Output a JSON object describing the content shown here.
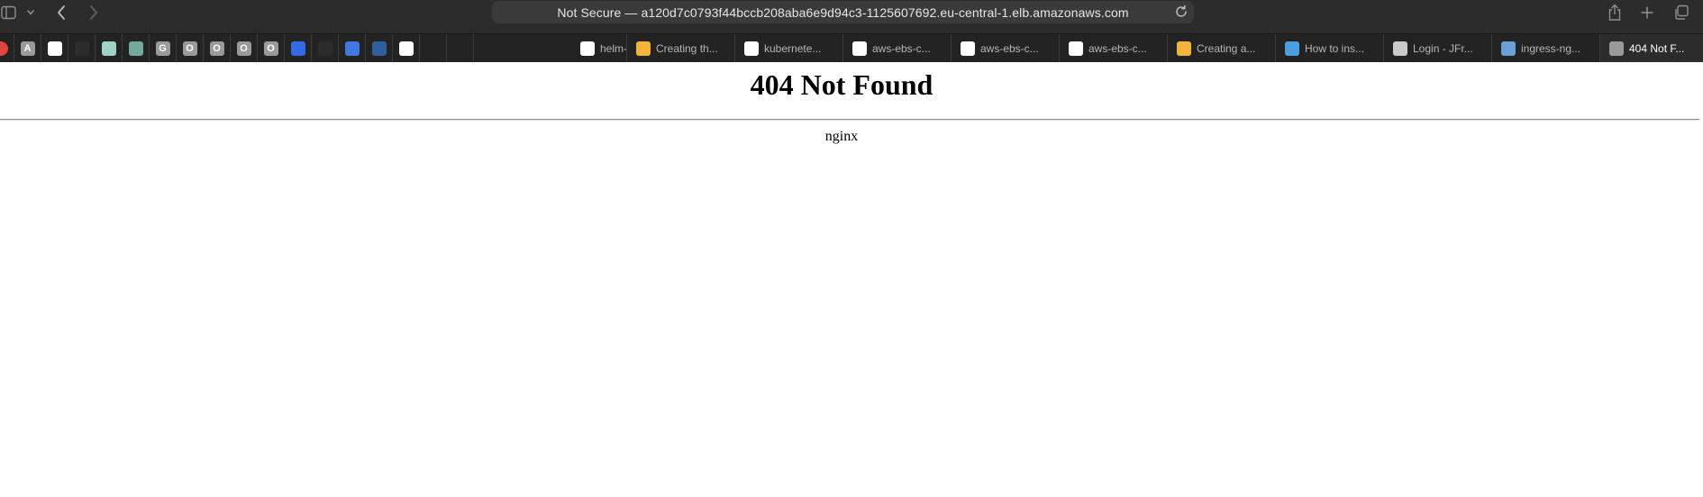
{
  "browser": {
    "address": "Not Secure — a120d7c0793f44bccb208aba6e9d94c3-1125607692.eu-central-1.elb.amazonaws.com",
    "toolbar_icons": [
      "sidebar-icon",
      "chevron-down-icon",
      "back-icon",
      "forward-icon",
      "share-icon",
      "new-tab-icon",
      "tab-overview-icon",
      "reload-icon"
    ]
  },
  "pinned_tabs": [
    {
      "icon": "red-circle-icon",
      "glyph": "",
      "bg": "#e0443e",
      "fg": "#ffffff"
    },
    {
      "icon": "letter-a-icon",
      "glyph": "A",
      "bg": "#9a9a9a",
      "fg": "#ffffff"
    },
    {
      "icon": "github-icon",
      "glyph": "",
      "bg": "#ffffff",
      "fg": "#000000"
    },
    {
      "icon": "stackoverflow-icon",
      "glyph": "",
      "bg": "#2c2c2c",
      "fg": "#f48024"
    },
    {
      "icon": "app-icon",
      "glyph": "",
      "bg": "#9fd3c7",
      "fg": "#2c2c2c"
    },
    {
      "icon": "openai-icon",
      "glyph": "",
      "bg": "#74aa9c",
      "fg": "#ffffff"
    },
    {
      "icon": "letter-g-icon",
      "glyph": "G",
      "bg": "#9a9a9a",
      "fg": "#ffffff"
    },
    {
      "icon": "letter-o-icon",
      "glyph": "O",
      "bg": "#9a9a9a",
      "fg": "#ffffff"
    },
    {
      "icon": "letter-o-icon",
      "glyph": "O",
      "bg": "#9a9a9a",
      "fg": "#ffffff"
    },
    {
      "icon": "letter-o-icon",
      "glyph": "O",
      "bg": "#9a9a9a",
      "fg": "#ffffff"
    },
    {
      "icon": "letter-o-icon",
      "glyph": "O",
      "bg": "#9a9a9a",
      "fg": "#ffffff"
    },
    {
      "icon": "kubernetes-icon",
      "glyph": "",
      "bg": "#326ce5",
      "fg": "#ffffff"
    },
    {
      "icon": "argo-icon",
      "glyph": "",
      "bg": "#2c2c2c",
      "fg": "#7fb8ff"
    },
    {
      "icon": "app-icon",
      "glyph": "",
      "bg": "#3f78e0",
      "fg": "#ffffff"
    },
    {
      "icon": "hexagon-icon",
      "glyph": "",
      "bg": "#2f5f9e",
      "fg": "#ffffff"
    },
    {
      "icon": "jira-icon",
      "glyph": "",
      "bg": "#ffffff",
      "fg": "#2684ff"
    },
    {
      "icon": "blank-icon",
      "glyph": "",
      "bg": "#232323",
      "fg": "#232323"
    },
    {
      "icon": "blank-icon",
      "glyph": "",
      "bg": "#232323",
      "fg": "#232323"
    }
  ],
  "tabs": [
    {
      "title": "helm-",
      "icon": "github-icon",
      "bg": "#ffffff",
      "active": false
    },
    {
      "title": "Creating th...",
      "icon": "aws-box-icon",
      "bg": "#f2b43a",
      "active": false
    },
    {
      "title": "kubernete...",
      "icon": "github-icon",
      "bg": "#ffffff",
      "active": false
    },
    {
      "title": "aws-ebs-c...",
      "icon": "github-icon",
      "bg": "#ffffff",
      "active": false
    },
    {
      "title": "aws-ebs-c...",
      "icon": "github-icon",
      "bg": "#ffffff",
      "active": false
    },
    {
      "title": "aws-ebs-c...",
      "icon": "github-icon",
      "bg": "#ffffff",
      "active": false
    },
    {
      "title": "Creating a...",
      "icon": "aws-box-icon",
      "bg": "#f2b43a",
      "active": false
    },
    {
      "title": "How to ins...",
      "icon": "octopus-icon",
      "bg": "#4a9fe0",
      "active": false
    },
    {
      "title": "Login - JFr...",
      "icon": "jfrog-icon",
      "bg": "#c9c9c9",
      "active": false
    },
    {
      "title": "ingress-ng...",
      "icon": "hexagon-icon",
      "bg": "#6aa0d8",
      "active": false
    },
    {
      "title": "404 Not F...",
      "icon": "letter-a-icon",
      "bg": "#9a9a9a",
      "active": true
    }
  ],
  "page": {
    "heading": "404 Not Found",
    "server": "nginx"
  }
}
